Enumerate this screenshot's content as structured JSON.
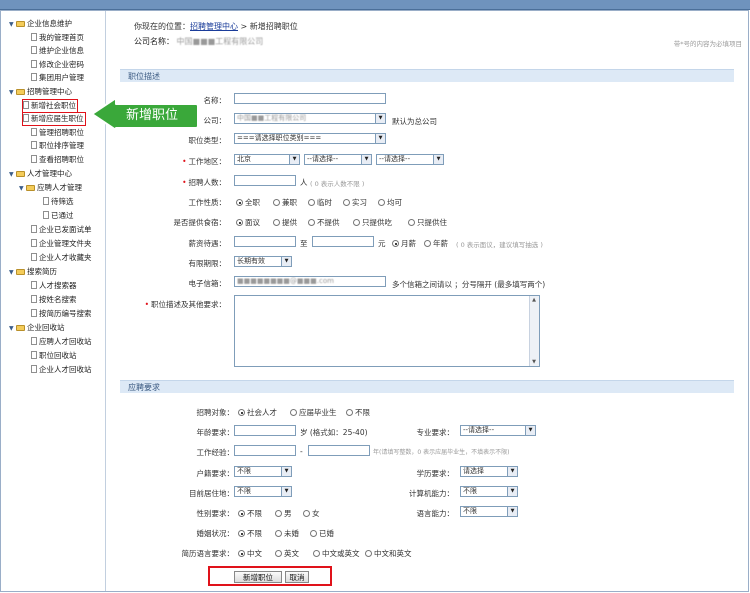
{
  "sidebar": {
    "groups": [
      {
        "label": "企业信息维护",
        "items": [
          "我的管理首页",
          "维护企业信息",
          "修改企业密码",
          "集团用户管理"
        ]
      },
      {
        "label": "招聘管理中心",
        "items": [
          "新增社会职位",
          "新增应届生职位",
          "管理招聘职位",
          "职位排序管理",
          "查看招聘职位"
        ]
      },
      {
        "label": "人才管理中心",
        "subgroup": "应聘人才管理",
        "subitems": [
          "待筛选",
          "已通过"
        ],
        "items": [
          "企业已发面试单",
          "企业管理文件夹",
          "企业人才收藏夹"
        ]
      },
      {
        "label": "搜索简历",
        "items": [
          "人才搜索器",
          "按姓名搜索",
          "按简历编号搜索"
        ]
      },
      {
        "label": "企业回收站",
        "items": [
          "应聘人才回收站",
          "职位回收站",
          "企业人才回收站"
        ]
      }
    ]
  },
  "callout": {
    "label": "新增职位"
  },
  "header": {
    "breadcrumb_prefix": "你现在的位置：",
    "breadcrumb_link": "招聘管理中心",
    "breadcrumb_sep": " > ",
    "breadcrumb_current": "新增招聘职位",
    "company_label": "公司名称：",
    "company_value": "中国■■■工程有限公司",
    "required_note": "带*号的内容为必填项目"
  },
  "sections": {
    "job_desc": "职位描述",
    "requirements": "应聘要求"
  },
  "form": {
    "job_name": {
      "label": "名称：",
      "value": ""
    },
    "company": {
      "label": "公司：",
      "value": "中国■■工程有限公司",
      "note": "默认为总公司"
    },
    "job_type": {
      "label": "职位类型：",
      "value": "===请选择职位类别==="
    },
    "location": {
      "label": "工作地区：",
      "province": "北京",
      "city": "--请选择--",
      "district": "--请选择--"
    },
    "headcount": {
      "label": "招聘人数：",
      "unit": "人",
      "hint": "( 0 表示人数不限 )"
    },
    "work_type": {
      "label": "工作性质：",
      "options": [
        "全职",
        "兼职",
        "临时",
        "实习",
        "均可"
      ],
      "selected": 0
    },
    "lodging": {
      "label": "是否提供食宿：",
      "options": [
        "面议",
        "提供",
        "不提供",
        "只提供吃",
        "只提供住"
      ],
      "selected": 0
    },
    "salary": {
      "label": "薪资待遇：",
      "to": "至",
      "unit": "元",
      "options": [
        "月薪",
        "年薪"
      ],
      "selected": 0,
      "hint": "( 0 表示面议，建议填写抽选 )"
    },
    "validity": {
      "label": "有限期限：",
      "value": "长期有效"
    },
    "email": {
      "label": "电子信箱：",
      "value": "■■■■■■■■@■■■.com",
      "hint": "多个信箱之间请以 ；分号隔开 (最多填写两个)"
    },
    "description": {
      "label": "职位描述及其他要求："
    }
  },
  "req": {
    "target": {
      "label": "招聘对象：",
      "options": [
        "社会人才",
        "应届毕业生",
        "不限"
      ],
      "selected": 0
    },
    "age": {
      "label": "年龄要求：",
      "hint": "岁 (格式如：25-40)"
    },
    "major": {
      "label": "专业要求：",
      "value": "--请选择--"
    },
    "experience": {
      "label": "工作经验：",
      "dash": "-",
      "hint": "年(请填写整数，0 表示应届毕业生，不填表示不限)"
    },
    "hukou": {
      "label": "户籍要求：",
      "value": "不限"
    },
    "education": {
      "label": "学历要求：",
      "value": "请选择"
    },
    "residence": {
      "label": "目前居住地：",
      "value": "不限"
    },
    "computer": {
      "label": "计算机能力：",
      "value": "不限"
    },
    "gender": {
      "label": "性别要求：",
      "options": [
        "不限",
        "男",
        "女"
      ],
      "selected": 0
    },
    "language": {
      "label": "语言能力：",
      "value": "不限"
    },
    "marital": {
      "label": "婚姻状况：",
      "options": [
        "不限",
        "未婚",
        "已婚"
      ],
      "selected": 0
    },
    "resume_lang": {
      "label": "简历语言要求：",
      "options": [
        "中文",
        "英文",
        "中文或英文",
        "中文和英文"
      ],
      "selected": 0
    }
  },
  "buttons": {
    "submit": "新增职位",
    "cancel": "取消"
  },
  "colors": {
    "accent": "#3b5a82",
    "highlight": "#e0121a",
    "callout": "#3aa83a"
  }
}
